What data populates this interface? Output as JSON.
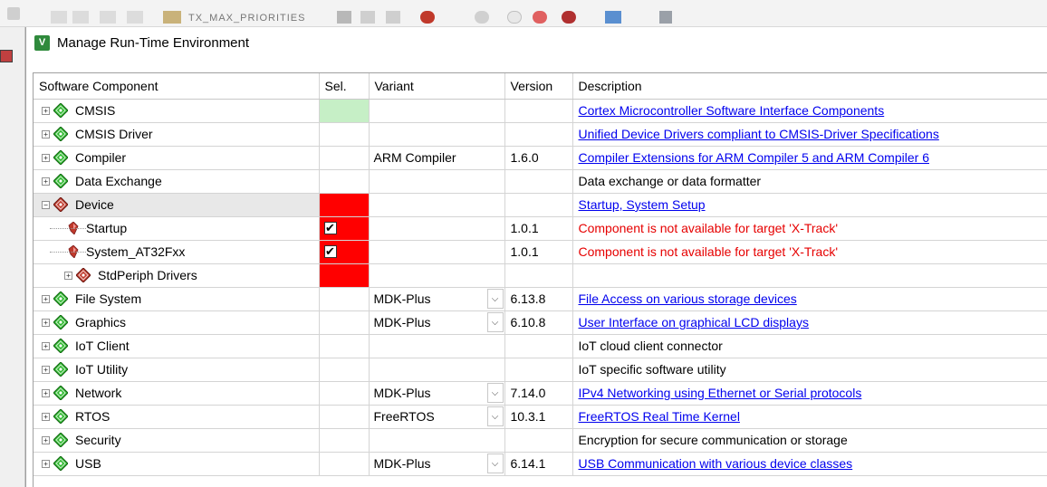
{
  "toolbar": {
    "target_label": "TX_MAX_PRIORITIES"
  },
  "dialog": {
    "title": "Manage Run-Time Environment"
  },
  "colors": {
    "selected_ok": "#c6efc6",
    "selected_error": "#ff0000",
    "link": "#0000ee",
    "error_text": "#e60000",
    "gem_green": "#2db82d",
    "gem_red": "#c0392b"
  },
  "columns": [
    "Software Component",
    "Sel.",
    "Variant",
    "Version",
    "Description"
  ],
  "rows": [
    {
      "name": "CMSIS",
      "level": 0,
      "expander": "+",
      "icon": "green-gem-icon",
      "sel": "green",
      "variant": "",
      "dropdown": false,
      "version": "",
      "description": "Cortex Microcontroller Software Interface Components",
      "desc_style": "link"
    },
    {
      "name": "CMSIS Driver",
      "level": 0,
      "expander": "+",
      "icon": "green-gem-icon",
      "sel": "",
      "variant": "",
      "dropdown": false,
      "version": "",
      "description": "Unified Device Drivers compliant to CMSIS-Driver Specifications",
      "desc_style": "link"
    },
    {
      "name": "Compiler",
      "level": 0,
      "expander": "+",
      "icon": "green-gem-icon",
      "sel": "",
      "variant": "ARM Compiler",
      "dropdown": false,
      "version": "1.6.0",
      "description": "Compiler Extensions for ARM Compiler 5 and ARM Compiler 6",
      "desc_style": "link"
    },
    {
      "name": "Data Exchange",
      "level": 0,
      "expander": "+",
      "icon": "green-gem-icon",
      "sel": "",
      "variant": "",
      "dropdown": false,
      "version": "",
      "description": "Data exchange or data formatter",
      "desc_style": "plain"
    },
    {
      "name": "Device",
      "level": 0,
      "expander": "−",
      "icon": "red-gem-icon",
      "sel": "red",
      "variant": "",
      "dropdown": false,
      "version": "",
      "description": "Startup, System Setup",
      "desc_style": "link",
      "selected_row": true
    },
    {
      "name": "Startup",
      "level": 1,
      "expander": "",
      "icon": "red-ruby-icon",
      "sel": "red-check",
      "variant": "",
      "dropdown": false,
      "version": "1.0.1",
      "description": "Component is not available for target 'X-Track'",
      "desc_style": "error"
    },
    {
      "name": "System_AT32Fxx",
      "level": 1,
      "expander": "",
      "icon": "red-ruby-icon",
      "sel": "red-check",
      "variant": "",
      "dropdown": false,
      "version": "1.0.1",
      "description": "Component is not available for target 'X-Track'",
      "desc_style": "error"
    },
    {
      "name": "StdPeriph Drivers",
      "level": 1,
      "expander": "+",
      "icon": "red-gem-icon",
      "sel": "red",
      "variant": "",
      "dropdown": false,
      "version": "",
      "description": "",
      "desc_style": "plain"
    },
    {
      "name": "File System",
      "level": 0,
      "expander": "+",
      "icon": "green-gem-icon",
      "sel": "",
      "variant": "MDK-Plus",
      "dropdown": true,
      "version": "6.13.8",
      "description": "File Access on various storage devices",
      "desc_style": "link"
    },
    {
      "name": "Graphics",
      "level": 0,
      "expander": "+",
      "icon": "green-gem-icon",
      "sel": "",
      "variant": "MDK-Plus",
      "dropdown": true,
      "version": "6.10.8",
      "description": "User Interface on graphical LCD displays",
      "desc_style": "link"
    },
    {
      "name": "IoT Client",
      "level": 0,
      "expander": "+",
      "icon": "green-gem-icon",
      "sel": "",
      "variant": "",
      "dropdown": false,
      "version": "",
      "description": "IoT cloud client connector",
      "desc_style": "plain"
    },
    {
      "name": "IoT Utility",
      "level": 0,
      "expander": "+",
      "icon": "green-gem-icon",
      "sel": "",
      "variant": "",
      "dropdown": false,
      "version": "",
      "description": "IoT specific software utility",
      "desc_style": "plain"
    },
    {
      "name": "Network",
      "level": 0,
      "expander": "+",
      "icon": "green-gem-icon",
      "sel": "",
      "variant": "MDK-Plus",
      "dropdown": true,
      "version": "7.14.0",
      "description": "IPv4 Networking using Ethernet or Serial protocols",
      "desc_style": "link"
    },
    {
      "name": "RTOS",
      "level": 0,
      "expander": "+",
      "icon": "green-gem-icon",
      "sel": "",
      "variant": "FreeRTOS",
      "dropdown": true,
      "version": "10.3.1",
      "description": "FreeRTOS Real Time Kernel",
      "desc_style": "link"
    },
    {
      "name": "Security",
      "level": 0,
      "expander": "+",
      "icon": "green-gem-icon",
      "sel": "",
      "variant": "",
      "dropdown": false,
      "version": "",
      "description": "Encryption for secure communication or storage",
      "desc_style": "plain"
    },
    {
      "name": "USB",
      "level": 0,
      "expander": "+",
      "icon": "green-gem-icon",
      "sel": "",
      "variant": "MDK-Plus",
      "dropdown": true,
      "version": "6.14.1",
      "description": "USB Communication with various device classes",
      "desc_style": "link"
    }
  ]
}
